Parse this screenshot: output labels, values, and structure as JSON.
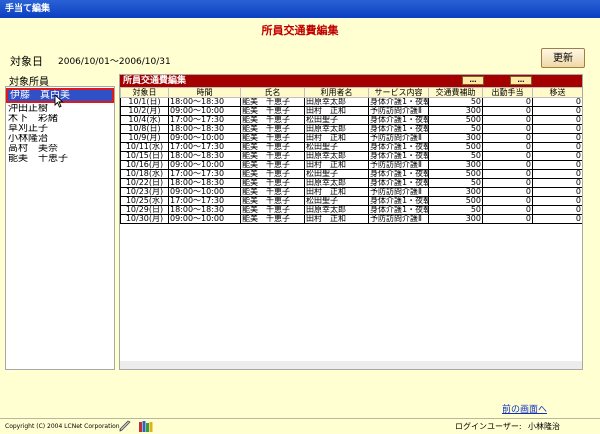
{
  "window": {
    "title": "手当て編集"
  },
  "page": {
    "title": "所員交通費編集"
  },
  "period": {
    "label": "対象日",
    "range": "2006/10/01～2006/10/31"
  },
  "toolbar": {
    "refresh_label": "更新"
  },
  "sidebar": {
    "title": "対象所員",
    "items": [
      {
        "label": "伊藤　真由美",
        "selected": true
      },
      {
        "label": "沖田正樹"
      },
      {
        "label": "木下　彩緒"
      },
      {
        "label": "草刈正子"
      },
      {
        "label": "小林隆治"
      },
      {
        "label": "高村　美奈"
      },
      {
        "label": "能美　千恵子"
      }
    ]
  },
  "panel": {
    "title": "所員交通費編集",
    "dots_label": "…",
    "columns": [
      "対象日",
      "時間",
      "氏名",
      "利用者名",
      "サービス内容",
      "交通費補助",
      "出勤手当",
      "移送"
    ],
    "rows": [
      [
        "10/1(日)",
        "18:00～18:30",
        "能美　千恵子",
        "田原幸太郎",
        "身体介護1・夜朝",
        "50",
        "0",
        "0"
      ],
      [
        "10/2(月)",
        "09:00～10:00",
        "能美　千恵子",
        "田村　正和",
        "予防訪問介護Ⅱ",
        "300",
        "0",
        "0"
      ],
      [
        "10/4(水)",
        "17:00～17:30",
        "能美　千恵子",
        "松田聖子",
        "身体介護1・夜朝",
        "500",
        "0",
        "0"
      ],
      [
        "10/8(日)",
        "18:00～18:30",
        "能美　千恵子",
        "田原幸太郎",
        "身体介護1・夜朝",
        "50",
        "0",
        "0"
      ],
      [
        "10/9(月)",
        "09:00～10:00",
        "能美　千恵子",
        "田村　正和",
        "予防訪問介護Ⅱ",
        "300",
        "0",
        "0"
      ],
      [
        "10/11(水)",
        "17:00～17:30",
        "能美　千恵子",
        "松田聖子",
        "身体介護1・夜朝",
        "500",
        "0",
        "0"
      ],
      [
        "10/15(日)",
        "18:00～18:30",
        "能美　千恵子",
        "田原幸太郎",
        "身体介護1・夜朝",
        "50",
        "0",
        "0"
      ],
      [
        "10/16(月)",
        "09:00～10:00",
        "能美　千恵子",
        "田村　正和",
        "予防訪問介護Ⅱ",
        "300",
        "0",
        "0"
      ],
      [
        "10/18(水)",
        "17:00～17:30",
        "能美　千恵子",
        "松田聖子",
        "身体介護1・夜朝",
        "500",
        "0",
        "0"
      ],
      [
        "10/22(日)",
        "18:00～18:30",
        "能美　千恵子",
        "田原幸太郎",
        "身体介護1・夜朝",
        "50",
        "0",
        "0"
      ],
      [
        "10/23(月)",
        "09:00～10:00",
        "能美　千恵子",
        "田村　正和",
        "予防訪問介護Ⅱ",
        "300",
        "0",
        "0"
      ],
      [
        "10/25(水)",
        "17:00～17:30",
        "能美　千恵子",
        "松田聖子",
        "身体介護1・夜朝",
        "500",
        "0",
        "0"
      ],
      [
        "10/29(日)",
        "18:00～18:30",
        "能美　千恵子",
        "田原幸太郎",
        "身体介護1・夜朝",
        "50",
        "0",
        "0"
      ],
      [
        "10/30(月)",
        "09:00～10:00",
        "能美　千恵子",
        "田村　正和",
        "予防訪問介護Ⅱ",
        "300",
        "0",
        "0"
      ]
    ]
  },
  "footer": {
    "back_link": "前の画面へ",
    "copyright": "Copyright (C) 2004 LCNet Corporation",
    "login_label": "ログインユーザー:",
    "login_user": "小林隆治"
  },
  "colors": {
    "background": "#ffffd2",
    "titlebar": "#0a3fc0",
    "accent_red": "#a50000",
    "page_title": "#c00000",
    "selection": "#3050c8"
  },
  "icons": [
    "mouse-cursor-icon",
    "pen-icon",
    "books-icon"
  ]
}
